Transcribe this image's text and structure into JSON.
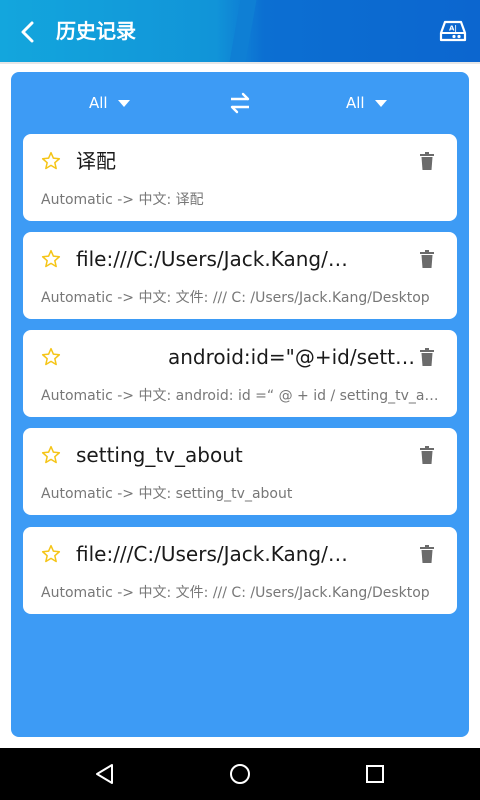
{
  "header": {
    "title": "历史记录",
    "back_icon": "chevron-left-icon",
    "right_icon": "translate-device-icon"
  },
  "filters": {
    "source_language": "All",
    "target_language": "All",
    "swap_icon": "swap-arrows-icon"
  },
  "history": [
    {
      "title": "译配",
      "subtitle": "Automatic -> 中文:   译配",
      "starred": false
    },
    {
      "title": "file:///C:/Users/Jack.Kang/Desktop",
      "subtitle": "Automatic -> 中文:   文件: /// C:  /Users/Jack.Kang/Desktop",
      "starred": false
    },
    {
      "title": "android:id=\"@+id/setting_tv_about\"",
      "subtitle": "Automatic -> 中文:   android: id =“ @ + id / setting_tv_about",
      "starred": false
    },
    {
      "title": "setting_tv_about",
      "subtitle": "Automatic -> 中文:   setting_tv_about",
      "starred": false
    },
    {
      "title": "file:///C:/Users/Jack.Kang/Desktop",
      "subtitle": "Automatic -> 中文:   文件: /// C:  /Users/Jack.Kang/Desktop",
      "starred": false
    }
  ],
  "colors": {
    "header": "#1194d8",
    "panel": "#3d9bf5",
    "star": "#f5c518",
    "trash": "#6b6b6b"
  },
  "navbar": {
    "back": "nav-back-icon",
    "home": "nav-home-icon",
    "recents": "nav-recents-icon"
  }
}
